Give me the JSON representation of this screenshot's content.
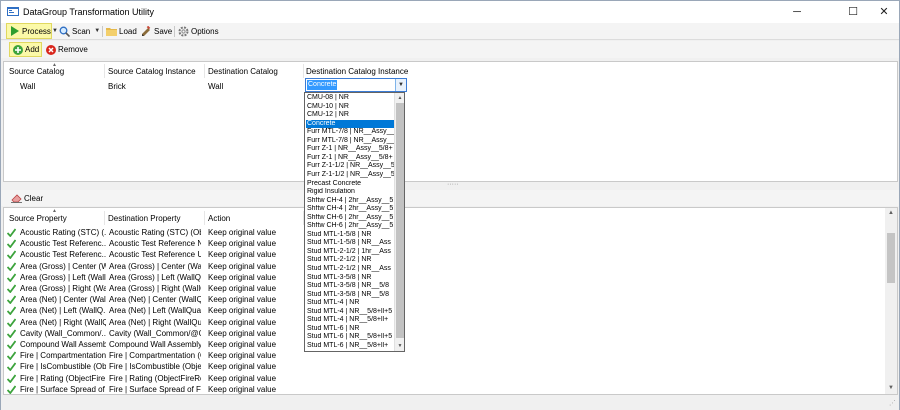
{
  "window": {
    "title": "DataGroup Transformation Utility",
    "minimize": "─",
    "maximize": "☐",
    "close": "✕"
  },
  "toolbar": {
    "process": "Process",
    "scan": "Scan",
    "load": "Load",
    "save": "Save",
    "options": "Options"
  },
  "catalog_toolbar": {
    "add": "Add",
    "remove": "Remove"
  },
  "catalog_grid": {
    "columns": [
      "Source Catalog",
      "Source Catalog Instance",
      "Destination Catalog",
      "Destination Catalog Instance"
    ],
    "row": {
      "source_catalog": "Wall",
      "source_instance": "Brick",
      "destination_catalog": "Wall",
      "destination_instance": "Concrete"
    }
  },
  "dropdown": {
    "selected": "Concrete",
    "options": [
      "CMU-08 | NR",
      "CMU-10 | NR",
      "CMU-12 | NR",
      "Concrete",
      "Furr MTL-7/8 | NR__Assy__",
      "Furr MTL-7/8 | NR__Assy__",
      "Furr Z-1 | NR__Assy__5/8+",
      "Furr Z-1 | NR__Assy__5/8+",
      "Furr Z-1-1/2 | NR__Assy__5",
      "Furr Z-1-1/2 | NR__Assy__5",
      "Precast Concrete",
      "Rigid Insulation",
      "Shftw CH-4 | 2hr__Assy__5",
      "Shftw CH-4 | 2hr__Assy__5",
      "Shftw CH-6 | 2hr__Assy__5",
      "Shftw CH-6 | 2hr__Assy__5",
      "Stud MTL-1-5/8 | NR",
      "Stud MTL-1-5/8 | NR__Ass",
      "Stud MTL-2-1/2 | 1hr__Ass",
      "Stud MTL-2-1/2 | NR",
      "Stud MTL-2-1/2 | NR__Ass",
      "Stud MTL-3-5/8 | NR",
      "Stud MTL-3-5/8 | NR__5/8",
      "Stud MTL-3-5/8 | NR__5/8",
      "Stud MTL-4 | NR",
      "Stud MTL-4 | NR__5/8+ll+5",
      "Stud MTL-4 | NR__5/8+ll+",
      "Stud MTL-6 | NR",
      "Stud MTL-6 | NR__5/8+ll+5",
      "Stud MTL-6 | NR__5/8+ll+"
    ]
  },
  "property_toolbar": {
    "clear": "Clear"
  },
  "property_grid": {
    "columns": [
      "Source Property",
      "Destination Property",
      "Action"
    ],
    "rows": [
      {
        "source": "Acoustic Rating (STC) (...",
        "destination": "Acoustic Rating (STC) (Obj...",
        "action": "Keep original value"
      },
      {
        "source": "Acoustic Test Referenc...",
        "destination": "Acoustic Test Reference N...",
        "action": "Keep original value"
      },
      {
        "source": "Acoustic Test Referenc...",
        "destination": "Acoustic Test Reference U...",
        "action": "Keep original value"
      },
      {
        "source": "Area (Gross) | Center (W...",
        "destination": "Area (Gross) | Center (Wal...",
        "action": "Keep original value"
      },
      {
        "source": "Area (Gross) | Left (Wall...",
        "destination": "Area (Gross) | Left (WallQu...",
        "action": "Keep original value"
      },
      {
        "source": "Area (Gross) | Right (Wall...",
        "destination": "Area (Gross) | Right (WallQ...",
        "action": "Keep original value"
      },
      {
        "source": "Area (Net) | Center (Wall...",
        "destination": "Area (Net) | Center (WallQ...",
        "action": "Keep original value"
      },
      {
        "source": "Area (Net) | Left (WallQ...",
        "destination": "Area (Net) | Left (WallQua...",
        "action": "Keep original value"
      },
      {
        "source": "Area (Net) | Right (WallQ...",
        "destination": "Area (Net) | Right (WallQu...",
        "action": "Keep original value"
      },
      {
        "source": "Cavity (Wall_Common/...",
        "destination": "Cavity (Wall_Common/@C...",
        "action": "Keep original value"
      },
      {
        "source": "Compound Wall Assembl...",
        "destination": "Compound Wall Assembly (...",
        "action": "Keep original value"
      },
      {
        "source": "Fire | Compartmentation (...",
        "destination": "Fire | Compartmentation (O...",
        "action": "Keep original value"
      },
      {
        "source": "Fire | IsCombustible (Obj...",
        "destination": "Fire | IsCombustible (Obje...",
        "action": "Keep original value"
      },
      {
        "source": "Fire | Rating (ObjectFire...",
        "destination": "Fire | Rating (ObjectFireRes...",
        "action": "Keep original value"
      },
      {
        "source": "Fire | Surface Spread of ...",
        "destination": "Fire | Surface Spread of Fla...",
        "action": "Keep original value"
      }
    ]
  },
  "colors": {
    "highlight": "#fbf9a8",
    "selection": "#0078d7",
    "check": "#3ca33c",
    "remove": "#d9261c"
  }
}
